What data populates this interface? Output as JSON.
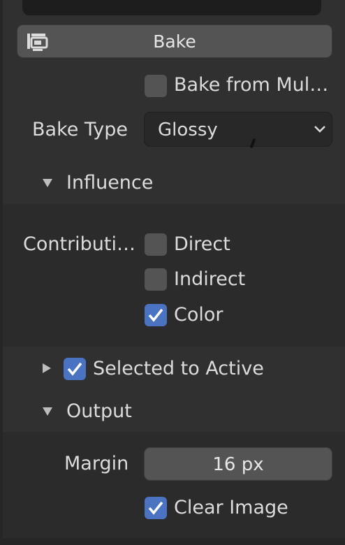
{
  "bake": {
    "button_label": "Bake"
  },
  "bake_from_multires": {
    "label": "Bake from Mul…",
    "checked": false
  },
  "bake_type": {
    "label": "Bake Type",
    "value": "Glossy"
  },
  "influence": {
    "header": "Influence",
    "expanded": true,
    "contributions_label": "Contributi…",
    "direct": {
      "label": "Direct",
      "checked": false
    },
    "indirect": {
      "label": "Indirect",
      "checked": false
    },
    "color": {
      "label": "Color",
      "checked": true
    }
  },
  "selected_to_active": {
    "label": "Selected to Active",
    "checked": true,
    "expanded": false
  },
  "output": {
    "header": "Output",
    "expanded": true,
    "margin_label": "Margin",
    "margin_value": "16 px",
    "clear_image": {
      "label": "Clear Image",
      "checked": true
    }
  },
  "colors": {
    "accent": "#4a73c2",
    "panel": "#303030",
    "subpanel": "#2b2b2b",
    "widget": "#545454"
  }
}
